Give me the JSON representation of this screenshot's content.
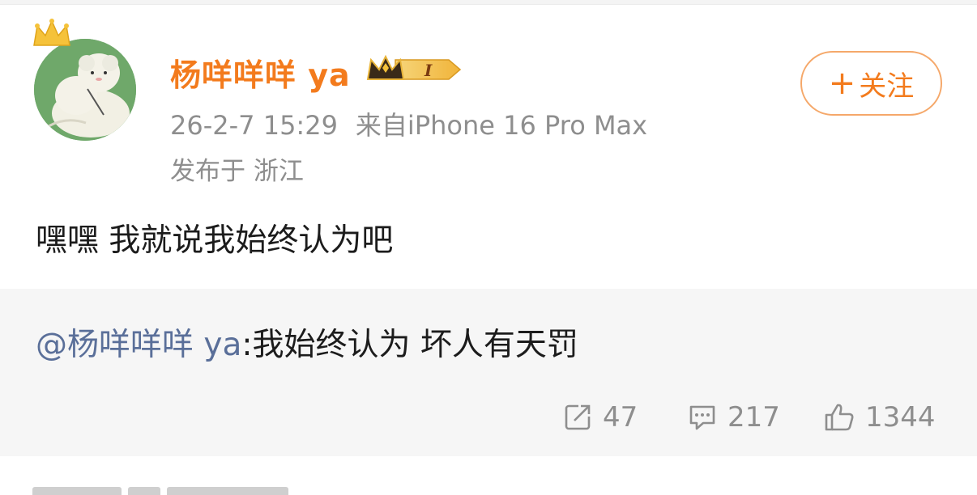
{
  "post": {
    "username": "杨咩咩咩 ya",
    "timestamp": "26-2-7 15:29",
    "source": "来自iPhone 16 Pro Max",
    "location": "发布于 浙江",
    "content": "嘿嘿 我就说我始终认为吧"
  },
  "follow": {
    "plus": "+",
    "label": "关注"
  },
  "repost": {
    "mention": "@杨咩咩咩 ya",
    "text": ":我始终认为 坏人有天罚"
  },
  "stats": {
    "reposts": "47",
    "comments": "217",
    "likes": "1344"
  },
  "icons": {
    "avatar": "sheep-avatar-icon",
    "crown": "crown-icon",
    "vip": "vip-level-badge-icon",
    "repost": "share-icon",
    "comment": "comment-icon",
    "like": "thumbs-up-icon"
  },
  "colors": {
    "username": "#f37b1d",
    "mention": "#5a6f99",
    "meta": "#8e8e8e",
    "follow_border": "#f5a86a",
    "repost_bg": "#f6f6f6"
  }
}
